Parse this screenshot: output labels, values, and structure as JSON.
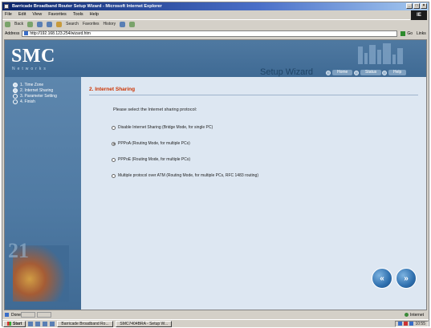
{
  "window": {
    "title": "Barricade Broadband Router Setup Wizard - Microsoft Internet Explorer",
    "ie_logo": "IE"
  },
  "menu": [
    "File",
    "Edit",
    "View",
    "Favorites",
    "Tools",
    "Help"
  ],
  "toolbar": {
    "back": "Back",
    "forward": "Forward",
    "search": "Search",
    "favorites": "Favorites",
    "history": "History"
  },
  "address": {
    "label": "Address",
    "url": "http://192.168.123.254/wizard.htm",
    "go": "Go",
    "links": "Links"
  },
  "header": {
    "logo": "SMC",
    "tagline": "Networks",
    "wizard_title": "Setup Wizard",
    "nav": {
      "home": "Home",
      "status": "Status",
      "help": "Help"
    }
  },
  "sidebar": {
    "steps": [
      {
        "label": "1. Time Zone"
      },
      {
        "label": "2. Internet Sharing"
      },
      {
        "label": "3. Parameter Setting"
      },
      {
        "label": "4. Finish"
      }
    ],
    "graphic_number": "21"
  },
  "main": {
    "section_title": "2. Internet Sharing",
    "prompt": "Please select the Internet sharing protocol:",
    "options": [
      {
        "label": "Disable Internet Sharing (Bridge Mode, for single PC)",
        "selected": false
      },
      {
        "label": "PPPoA (Routing Mode, for multiple PCs)",
        "selected": true
      },
      {
        "label": "PPPoE (Routing Mode, for multiple PCs)",
        "selected": false
      },
      {
        "label": "Multiple protocol over ATM (Routing Mode, for multiple PCs, RFC 1483 routing)",
        "selected": false
      }
    ],
    "back_glyph": "«",
    "next_glyph": "»"
  },
  "statusbar": {
    "text": "Done",
    "zone": "Internet"
  },
  "taskbar": {
    "start": "Start",
    "tasks": [
      "Barricade Broadband Ro...",
      "SMC7404BRA - Setup W..."
    ],
    "clock": "10:55"
  },
  "colors": {
    "header_blue": "#3f6a94",
    "main_bg": "#dde7f2",
    "section_title": "#cc3300"
  }
}
